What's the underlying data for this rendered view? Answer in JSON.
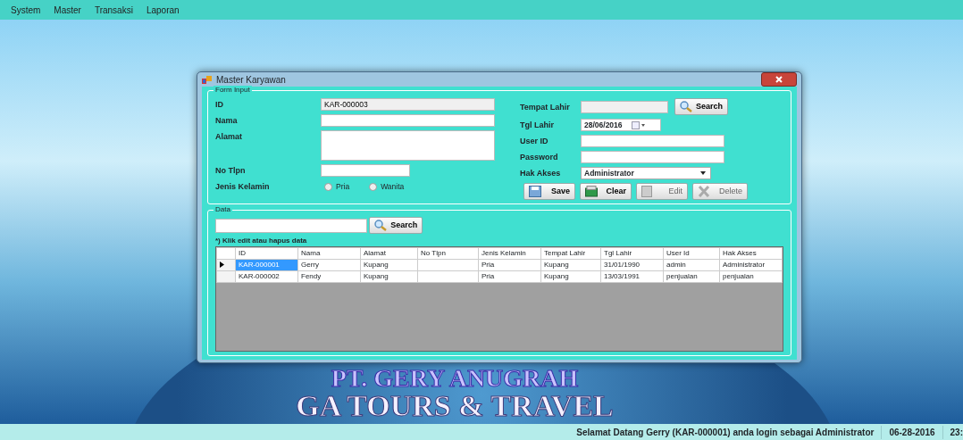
{
  "menu": [
    "System",
    "Master",
    "Transaksi",
    "Laporan"
  ],
  "window": {
    "title": "Master Karyawan",
    "form_input": {
      "legend": "Form Input",
      "left_fields": [
        {
          "kind": "text",
          "label": "ID",
          "value": "KAR-000003",
          "readonly": true
        },
        {
          "kind": "text",
          "label": "Nama"
        },
        {
          "kind": "textarea",
          "label": "Alamat"
        },
        {
          "kind": "short",
          "label": "No Tlpn"
        },
        {
          "kind": "radio",
          "label": "Jenis Kelamin",
          "options": [
            {
              "label": "Pria",
              "selected": false
            },
            {
              "label": "Wanita",
              "selected": false
            }
          ]
        }
      ],
      "right_fields": [
        {
          "kind": "search",
          "label": "Tempat Lahir",
          "readonly": true,
          "button": "Search"
        },
        {
          "kind": "date",
          "label": "Tgl Lahir",
          "value": "28/06/2016"
        },
        {
          "kind": "text",
          "label": "User ID"
        },
        {
          "kind": "text",
          "label": "Password"
        },
        {
          "kind": "combo",
          "label": "Hak Akses",
          "value": "Administrator"
        }
      ],
      "buttons": [
        {
          "label": "Save",
          "disabled": false
        },
        {
          "label": "Clear",
          "disabled": false
        },
        {
          "label": "Edit",
          "disabled": true
        },
        {
          "label": "Delete",
          "disabled": true
        }
      ]
    },
    "data": {
      "legend": "Data",
      "search_button": "Search",
      "hint": "*) Klik edit atau hapus data",
      "columns": [
        "ID",
        "Nama",
        "Alamat",
        "No Tlpn",
        "Jenis Kelamin",
        "Tempat Lahir",
        "Tgl Lahir",
        "User Id",
        "Hak Akses"
      ],
      "rows": [
        {
          "selected": true,
          "cells": [
            "KAR-000001",
            "Gerry",
            "Kupang",
            "",
            "Pria",
            "Kupang",
            "31/01/1990",
            "admin",
            "Administrator"
          ]
        },
        {
          "selected": false,
          "cells": [
            "KAR-000002",
            "Fendy",
            "Kupang",
            "",
            "Pria",
            "Kupang",
            "13/03/1991",
            "penjualan",
            "penjualan"
          ]
        }
      ]
    }
  },
  "background": {
    "banner_lines": [
      "PT. GERY ANUGRAH",
      "GA TOURS & TRAVEL"
    ]
  },
  "status_bar": {
    "message": "Selamat Datang Gerry (KAR-000001) anda login sebagai Administrator",
    "date": "06-28-2016",
    "time": "23:"
  }
}
